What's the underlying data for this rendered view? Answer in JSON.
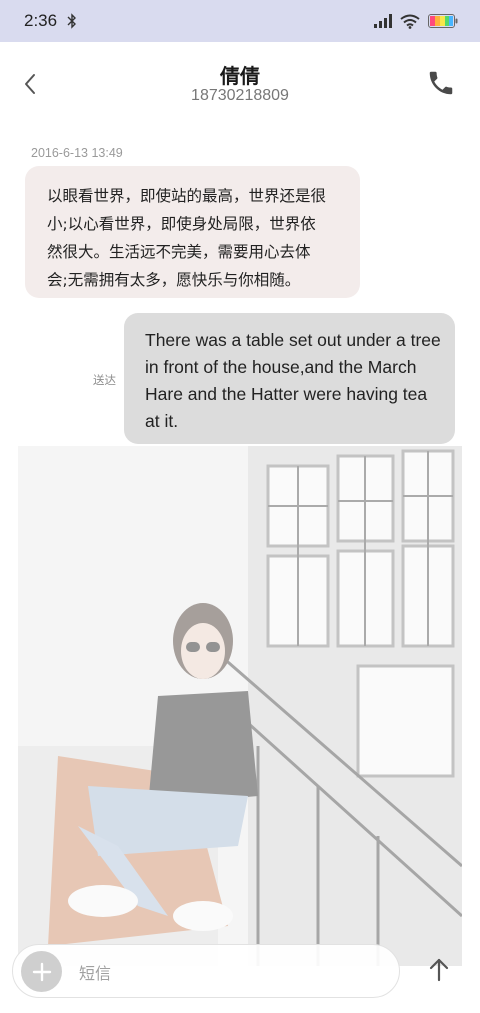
{
  "status_bar": {
    "time": "2:36",
    "icons": [
      "bluetooth-icon",
      "signal-icon",
      "wifi-icon",
      "battery-icon"
    ]
  },
  "header": {
    "contact_name": "倩倩",
    "contact_number": "18730218809",
    "icons": [
      "back-arrow-icon",
      "phone-icon"
    ]
  },
  "conversation": {
    "timestamp": "2016-6-13 13:49",
    "incoming": {
      "lines": [
        "以眼看世界，即使站的最高，世界还是很",
        "小;以心看世界，即使身处局限，世界依",
        "然很大。生活远不完美，需要用心去体",
        "会;无需拥有太多，愿快乐与你相随。"
      ]
    },
    "outgoing": {
      "lines": [
        "There was a table set out under a tree",
        "in front of the house,and the March",
        "Hare and the Hatter were having tea",
        "at it."
      ],
      "status": "送达"
    },
    "image_message": {
      "icon": "photo-image"
    }
  },
  "composer": {
    "placeholder": "短信",
    "value": "",
    "icons": [
      "plus-icon",
      "send-arrow-icon"
    ]
  },
  "colors": {
    "status_bar_bg": "#d9dbef",
    "incoming_bubble": "#f3eceb",
    "outgoing_bubble": "#dcdcdc",
    "meta_text": "#9a9a9a"
  }
}
